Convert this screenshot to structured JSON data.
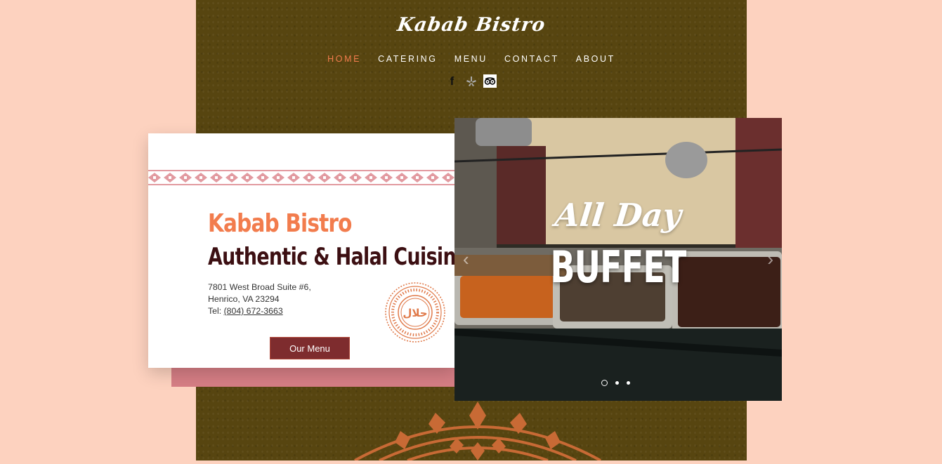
{
  "site": {
    "logo_text": "Kabab Bistro"
  },
  "nav": {
    "items": [
      {
        "label": "HOME",
        "active": true
      },
      {
        "label": "CATERING",
        "active": false
      },
      {
        "label": "MENU",
        "active": false
      },
      {
        "label": "CONTACT",
        "active": false
      },
      {
        "label": "ABOUT",
        "active": false
      }
    ]
  },
  "social": {
    "icons": [
      "facebook-icon",
      "yelp-icon",
      "tripadvisor-icon"
    ]
  },
  "card": {
    "brand": "Kabab Bistro",
    "tagline": "Authentic & Halal Cuisine",
    "address_line1": "7801 West Broad Suite #6,",
    "address_line2": "Henrico, VA 23294",
    "tel_label": "Tel:",
    "phone": "(804) 672-3663",
    "halal_text": "حلال",
    "button_label": "Our Menu"
  },
  "hero": {
    "script_text": "All Day",
    "big_text": "BUFFET",
    "slide_count": 3,
    "active_slide": 1
  },
  "colors": {
    "background": "#fdd2bf",
    "strip": "#574510",
    "accent": "#f27c4d",
    "dark_text": "#3c0f12",
    "button": "#7e2c2e",
    "pattern": "#d67e85"
  }
}
